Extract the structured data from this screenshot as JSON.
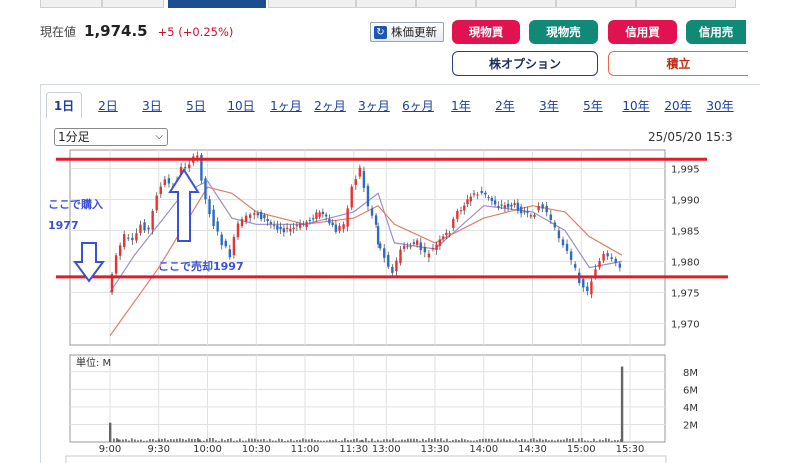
{
  "header": {
    "price_label": "現在値",
    "price_value": "1,974.5",
    "price_change": "+5",
    "price_change_pct": "(+0.25%)",
    "refresh_label": "株価更新"
  },
  "trade_buttons": {
    "buy": "現物買",
    "sell": "現物売",
    "margin_buy": "信用買",
    "margin_sell": "信用売",
    "option": "株オプション",
    "accumulate": "積立"
  },
  "period_tabs": [
    "1日",
    "2日",
    "3日",
    "5日",
    "10日",
    "1ヶ月",
    "2ヶ月",
    "3ヶ月",
    "6ヶ月",
    "1年",
    "2年",
    "3年",
    "5年",
    "10年",
    "20年",
    "30年"
  ],
  "interval_select": {
    "value": "1分足"
  },
  "date_stamp": "25/05/20 15:3",
  "annotations": {
    "buy_note": "ここで購入",
    "buy_price": "1977",
    "sell_note": "ここで売却1997"
  },
  "volume": {
    "unit_label": "単位: M"
  },
  "colors": {
    "accent_red": "#e0124f",
    "accent_green": "#108a77",
    "annotation_blue": "#3a52d9",
    "support_line": "#dd1c2c"
  },
  "chart_data": {
    "type": "line",
    "x_ticks": [
      "9:00",
      "9:30",
      "10:00",
      "10:30",
      "11:00",
      "11:30",
      "13:00",
      "13:30",
      "14:00",
      "14:30",
      "15:00",
      "15:30"
    ],
    "y_ticks": [
      "1,995",
      "1,990",
      "1,985",
      "1,980",
      "1,975",
      "1,970"
    ],
    "ylim": [
      1966.5,
      1998
    ],
    "volume_ticks": [
      "8M",
      "6M",
      "4M",
      "2M"
    ],
    "volume_ylim": [
      0,
      9
    ],
    "resistance_level": 1996.5,
    "support_level": 1977.5,
    "close_path": [
      {
        "t": "9:00",
        "v": 1975
      },
      {
        "t": "9:05",
        "v": 1981
      },
      {
        "t": "9:10",
        "v": 1984
      },
      {
        "t": "9:15",
        "v": 1983
      },
      {
        "t": "9:20",
        "v": 1986
      },
      {
        "t": "9:25",
        "v": 1985
      },
      {
        "t": "9:30",
        "v": 1991
      },
      {
        "t": "9:35",
        "v": 1993
      },
      {
        "t": "9:40",
        "v": 1992
      },
      {
        "t": "9:45",
        "v": 1995
      },
      {
        "t": "9:50",
        "v": 1996
      },
      {
        "t": "9:55",
        "v": 1997
      },
      {
        "t": "10:00",
        "v": 1990
      },
      {
        "t": "10:05",
        "v": 1986
      },
      {
        "t": "10:10",
        "v": 1983
      },
      {
        "t": "10:15",
        "v": 1981
      },
      {
        "t": "10:20",
        "v": 1986
      },
      {
        "t": "10:25",
        "v": 1987
      },
      {
        "t": "10:30",
        "v": 1988
      },
      {
        "t": "10:40",
        "v": 1986
      },
      {
        "t": "10:50",
        "v": 1985
      },
      {
        "t": "11:00",
        "v": 1986
      },
      {
        "t": "11:10",
        "v": 1988
      },
      {
        "t": "11:20",
        "v": 1985
      },
      {
        "t": "11:25",
        "v": 1986
      },
      {
        "t": "11:30",
        "v": 1992
      },
      {
        "t": "11:35",
        "v": 1995
      },
      {
        "t": "11:40",
        "v": 1989
      },
      {
        "t": "11:45",
        "v": 1986
      },
      {
        "t": "12:55",
        "v": 1983
      },
      {
        "t": "13:00",
        "v": 1981
      },
      {
        "t": "13:05",
        "v": 1978
      },
      {
        "t": "13:10",
        "v": 1982
      },
      {
        "t": "13:20",
        "v": 1983
      },
      {
        "t": "13:25",
        "v": 1981
      },
      {
        "t": "13:30",
        "v": 1982
      },
      {
        "t": "13:40",
        "v": 1985
      },
      {
        "t": "13:45",
        "v": 1988
      },
      {
        "t": "13:55",
        "v": 1991
      },
      {
        "t": "14:00",
        "v": 1991
      },
      {
        "t": "14:10",
        "v": 1989
      },
      {
        "t": "14:20",
        "v": 1989
      },
      {
        "t": "14:30",
        "v": 1987
      },
      {
        "t": "14:35",
        "v": 1989
      },
      {
        "t": "14:40",
        "v": 1988
      },
      {
        "t": "14:45",
        "v": 1985
      },
      {
        "t": "14:50",
        "v": 1983
      },
      {
        "t": "14:55",
        "v": 1980
      },
      {
        "t": "15:00",
        "v": 1977
      },
      {
        "t": "15:05",
        "v": 1975
      },
      {
        "t": "15:10",
        "v": 1979
      },
      {
        "t": "15:15",
        "v": 1981
      },
      {
        "t": "15:20",
        "v": 1980
      },
      {
        "t": "15:25",
        "v": 1979
      }
    ],
    "ma_series": [
      {
        "color": "#9a8fcf",
        "values": [
          {
            "t": "9:00",
            "v": 1975
          },
          {
            "t": "9:15",
            "v": 1981
          },
          {
            "t": "9:30",
            "v": 1986
          },
          {
            "t": "9:45",
            "v": 1991
          },
          {
            "t": "10:00",
            "v": 1993
          },
          {
            "t": "10:15",
            "v": 1987
          },
          {
            "t": "10:30",
            "v": 1986
          },
          {
            "t": "11:00",
            "v": 1986
          },
          {
            "t": "11:30",
            "v": 1988
          },
          {
            "t": "11:45",
            "v": 1991
          },
          {
            "t": "13:05",
            "v": 1983
          },
          {
            "t": "13:30",
            "v": 1982
          },
          {
            "t": "14:00",
            "v": 1989
          },
          {
            "t": "14:30",
            "v": 1988
          },
          {
            "t": "14:50",
            "v": 1985
          },
          {
            "t": "15:05",
            "v": 1979
          },
          {
            "t": "15:25",
            "v": 1980
          }
        ]
      },
      {
        "color": "#e27d66",
        "values": [
          {
            "t": "9:00",
            "v": 1968
          },
          {
            "t": "9:30",
            "v": 1979
          },
          {
            "t": "10:00",
            "v": 1992
          },
          {
            "t": "10:15",
            "v": 1991
          },
          {
            "t": "10:30",
            "v": 1988
          },
          {
            "t": "11:00",
            "v": 1986
          },
          {
            "t": "11:30",
            "v": 1987
          },
          {
            "t": "11:45",
            "v": 1989
          },
          {
            "t": "13:05",
            "v": 1986
          },
          {
            "t": "13:30",
            "v": 1983
          },
          {
            "t": "14:00",
            "v": 1987
          },
          {
            "t": "14:30",
            "v": 1989
          },
          {
            "t": "14:50",
            "v": 1988
          },
          {
            "t": "15:05",
            "v": 1984
          },
          {
            "t": "15:25",
            "v": 1981
          }
        ]
      }
    ],
    "volume_spikes": [
      {
        "t": "9:00",
        "v": 2.2
      },
      {
        "t": "9:05",
        "v": 0.3
      },
      {
        "t": "9:30",
        "v": 0.25
      },
      {
        "t": "9:55",
        "v": 0.3
      },
      {
        "t": "11:35",
        "v": 0.25
      },
      {
        "t": "15:25",
        "v": 8.6
      }
    ]
  }
}
